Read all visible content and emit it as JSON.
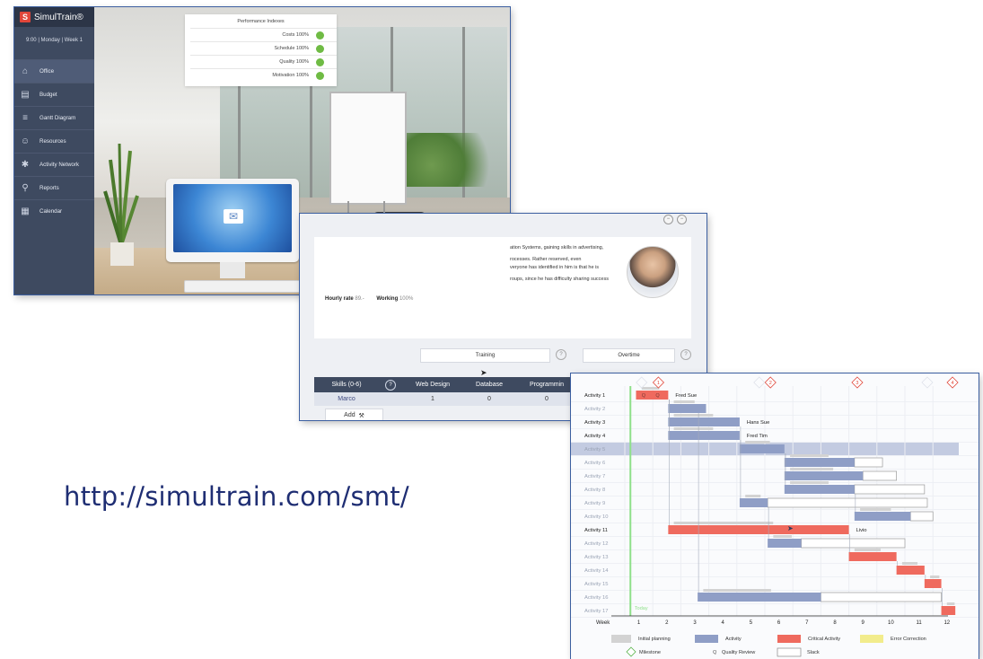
{
  "office": {
    "brand": "SimulTrain®",
    "brand_logo": "S",
    "clock": "9:00 | Monday | Week 1",
    "nav": [
      {
        "label": "Office",
        "icon": "home-icon",
        "glyph": "⌂"
      },
      {
        "label": "Budget",
        "icon": "budget-icon",
        "glyph": "▤"
      },
      {
        "label": "Gantt Diagram",
        "icon": "gantt-icon",
        "glyph": "≡"
      },
      {
        "label": "Resources",
        "icon": "people-icon",
        "glyph": "☺"
      },
      {
        "label": "Activity Network",
        "icon": "network-icon",
        "glyph": "✱"
      },
      {
        "label": "Reports",
        "icon": "magnifier-icon",
        "glyph": "⚲"
      },
      {
        "label": "Calendar",
        "icon": "calendar-icon",
        "glyph": "▦"
      }
    ],
    "performance": {
      "title": "Performance Indexes",
      "rows": [
        {
          "label": "Costs 100%",
          "status_color": "#6fbb44"
        },
        {
          "label": "Schedule 100%",
          "status_color": "#6fbb44"
        },
        {
          "label": "Quality 100%",
          "status_color": "#6fbb44"
        },
        {
          "label": "Motivation 100%",
          "status_color": "#6fbb44"
        }
      ]
    }
  },
  "resource": {
    "bio_1": "ation Systems, gaining skills in advertising,",
    "bio_2": "rocesses. Rather reserved, even",
    "bio_3": "veryone has identified in him is that he is",
    "bio_4": "roups, since he has difficulty sharing success",
    "hourly_rate_label": "Hourly rate",
    "hourly_rate_value": "89.-",
    "working_label": "Working",
    "working_value": "100%",
    "round_btn_1": "−",
    "round_btn_2": "−",
    "training_label": "Training",
    "overtime_label": "Overtime",
    "help_glyph": "?",
    "skills_headers": [
      "Skills (0-6)",
      "?",
      "Web Design",
      "Database",
      "Programmin"
    ],
    "skills_row": [
      "Marco",
      "1",
      "0",
      "0"
    ],
    "add_label": "Add",
    "add_icon": "⚒"
  },
  "gantt": {
    "activities": [
      "Activity 1",
      "Activity 2",
      "Activity 3",
      "Activity 4",
      "Activity 5",
      "Activity 6",
      "Activity 7",
      "Activity 8",
      "Activity 9",
      "Activity 10",
      "Activity 11",
      "Activity 12",
      "Activity 13",
      "Activity 14",
      "Activity 15",
      "Activity 16",
      "Activity 17"
    ],
    "bold_rows": [
      0,
      2,
      3,
      10
    ],
    "weeks_label": "Week",
    "weeks": [
      "1",
      "2",
      "3",
      "4",
      "5",
      "6",
      "7",
      "8",
      "9",
      "10",
      "11",
      "12"
    ],
    "milestones": [
      "1",
      "2",
      "3",
      "4"
    ],
    "today_label": "Today",
    "resource_labels": [
      {
        "row": 0,
        "text": "Fred Sue"
      },
      {
        "row": 2,
        "text": "Hans Sue"
      },
      {
        "row": 3,
        "text": "Fred Tim"
      },
      {
        "row": 10,
        "text": "Livio"
      }
    ],
    "quality_marks": [
      "Q",
      "Q"
    ],
    "bars": [
      {
        "row": 0,
        "kind": "critical",
        "start": 0.9,
        "end": 2.05,
        "slack_end": 2.05
      },
      {
        "row": 1,
        "kind": "activity",
        "start": 2.05,
        "end": 3.4,
        "slack_end": 3.4
      },
      {
        "row": 2,
        "kind": "activity",
        "start": 2.05,
        "end": 4.6,
        "slack_end": 4.6
      },
      {
        "row": 3,
        "kind": "activity",
        "start": 2.05,
        "end": 4.6,
        "slack_end": 4.6
      },
      {
        "row": 4,
        "kind": "activity",
        "start": 4.6,
        "end": 6.2,
        "slack_end": 6.2
      },
      {
        "row": 5,
        "kind": "activity",
        "start": 6.2,
        "end": 8.7,
        "slack_end": 9.7
      },
      {
        "row": 6,
        "kind": "activity",
        "start": 6.2,
        "end": 9.0,
        "slack_end": 10.2
      },
      {
        "row": 7,
        "kind": "activity",
        "start": 6.2,
        "end": 8.7,
        "slack_end": 11.2
      },
      {
        "row": 8,
        "kind": "activity",
        "start": 4.6,
        "end": 5.6,
        "slack_end": 11.3
      },
      {
        "row": 9,
        "kind": "activity",
        "start": 8.7,
        "end": 10.7,
        "slack_end": 11.5
      },
      {
        "row": 10,
        "kind": "critical",
        "start": 2.05,
        "end": 8.5,
        "slack_end": 8.5
      },
      {
        "row": 11,
        "kind": "activity",
        "start": 5.6,
        "end": 6.8,
        "slack_end": 10.5
      },
      {
        "row": 12,
        "kind": "critical",
        "start": 8.5,
        "end": 10.2,
        "slack_end": 10.2
      },
      {
        "row": 13,
        "kind": "critical",
        "start": 10.2,
        "end": 11.2,
        "slack_end": 11.2
      },
      {
        "row": 14,
        "kind": "critical",
        "start": 11.2,
        "end": 11.8,
        "slack_end": 11.8
      },
      {
        "row": 15,
        "kind": "activity",
        "start": 3.1,
        "end": 7.5,
        "slack_end": 11.8
      },
      {
        "row": 16,
        "kind": "critical",
        "start": 11.8,
        "end": 12.3,
        "slack_end": 12.3
      }
    ],
    "colors": {
      "activity": "#8f9ec6",
      "critical": "#ef6a5e",
      "planning": "#d3d3d3",
      "error": "#f2ec8c",
      "today": "#8fe08a",
      "milestone": "#e0473a",
      "highlight": "#c3cbe1"
    },
    "legend": [
      {
        "label": "Initial planning",
        "swatch": "planning"
      },
      {
        "label": "Activity",
        "swatch": "activity"
      },
      {
        "label": "Critical Activity",
        "swatch": "critical"
      },
      {
        "label": "Error Correction",
        "swatch": "error"
      },
      {
        "label": "Milestone",
        "swatch": "milestone-glyph"
      },
      {
        "label": "Quality Review",
        "swatch": "q-glyph"
      },
      {
        "label": "Slack",
        "swatch": "slack"
      }
    ]
  },
  "url": "http://simultrain.com/smt/"
}
